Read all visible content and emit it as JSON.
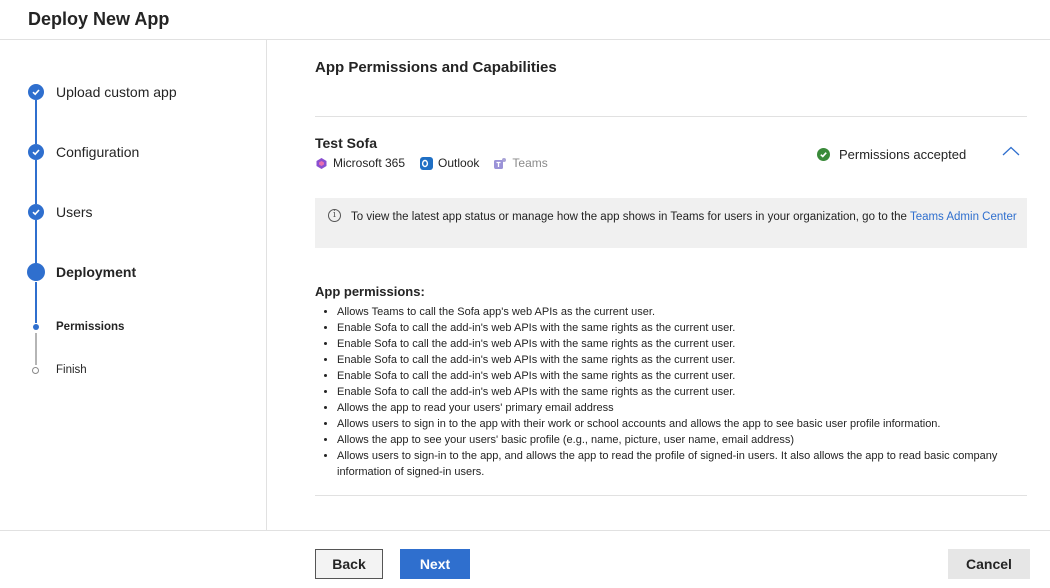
{
  "header": {
    "title": "Deploy New App"
  },
  "steps": {
    "upload": "Upload custom app",
    "configuration": "Configuration",
    "users": "Users",
    "deployment": "Deployment",
    "permissions": "Permissions",
    "finish": "Finish"
  },
  "main": {
    "section_title": "App Permissions and Capabilities",
    "app_name": "Test Sofa",
    "hosts": [
      "Microsoft 365",
      "Outlook",
      "Teams"
    ],
    "permission_status": "Permissions accepted",
    "info_text": "To view the latest app status or manage how the app shows in Teams for users in your organization, go to the",
    "info_link": "Teams Admin Center",
    "permissions_title": "App permissions:",
    "permissions": [
      "Allows Teams to call the Sofa app's web APIs as the current user.",
      "Enable Sofa to call the add-in's web APIs with the same rights as the current user.",
      "Enable Sofa to call the add-in's web APIs with the same rights as the current user.",
      "Enable Sofa to call the add-in's web APIs with the same rights as the current user.",
      "Enable Sofa to call the add-in's web APIs with the same rights as the current user.",
      "Enable Sofa to call the add-in's web APIs with the same rights as the current user.",
      "Allows the app to read your users' primary email address",
      "Allows users to sign in to the app with their work or school accounts and allows the app to see basic user profile information.",
      "Allows the app to see your users' basic profile (e.g., name, picture, user name, email address)",
      "Allows users to sign-in to the app, and allows the app to read the profile of signed-in users. It also allows the app to read basic company information of signed-in users."
    ]
  },
  "footer": {
    "back": "Back",
    "next": "Next",
    "cancel": "Cancel"
  },
  "colors": {
    "accent": "#2f6fce",
    "success": "#3a8a3a"
  }
}
